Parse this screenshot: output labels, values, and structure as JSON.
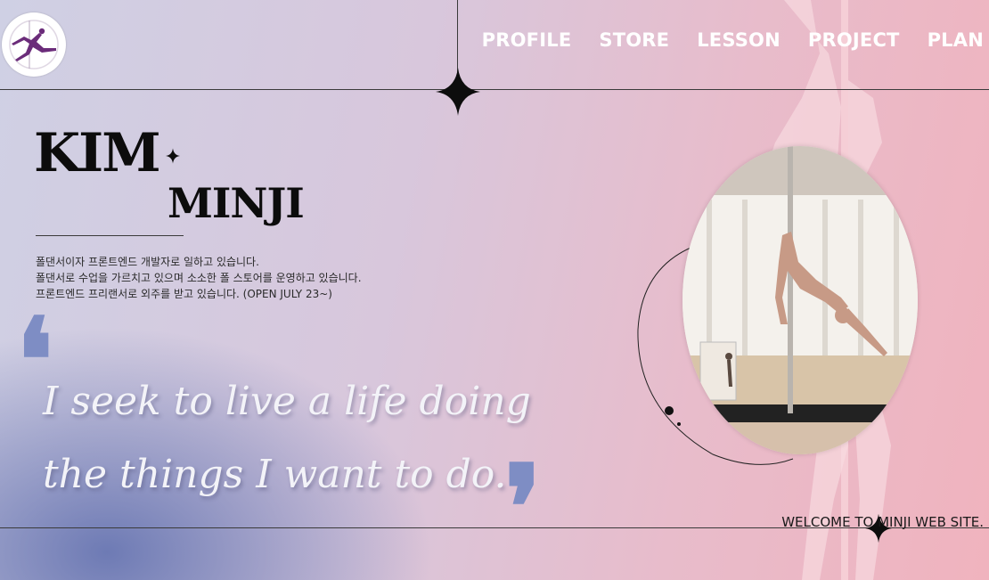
{
  "nav": [
    "PROFILE",
    "STORE",
    "LESSON",
    "PROJECT",
    "PLAN"
  ],
  "hero": {
    "first_name": "KIM",
    "last_name": "MINJI",
    "intro": [
      "폴댄서이자 프론트엔드 개발자로 일하고 있습니다.",
      "폴댄서로 수업을 가르치고 있으며 소소한 폴 스토어를 운영하고 있습니다.",
      "프론트엔드 프리랜서로 외주를 받고 있습니다. (OPEN JULY 23~)"
    ]
  },
  "quote": {
    "open_mark": "❛",
    "close_mark": "❜",
    "lines": [
      "I seek to live a life doing",
      "the things I want to do."
    ]
  },
  "footer": {
    "welcome": "WELCOME TO MINJI WEB SITE."
  },
  "icons": {
    "logo": "pole-dancer-logo-icon",
    "stars": "four-point-star-icon",
    "photo": "pole-dancer-photo"
  },
  "colors": {
    "accent_blue": "#7e8dc4",
    "logo_purple": "#6b2c7a",
    "text_dark": "#0c0c0c",
    "nav_text": "#ffffff"
  }
}
